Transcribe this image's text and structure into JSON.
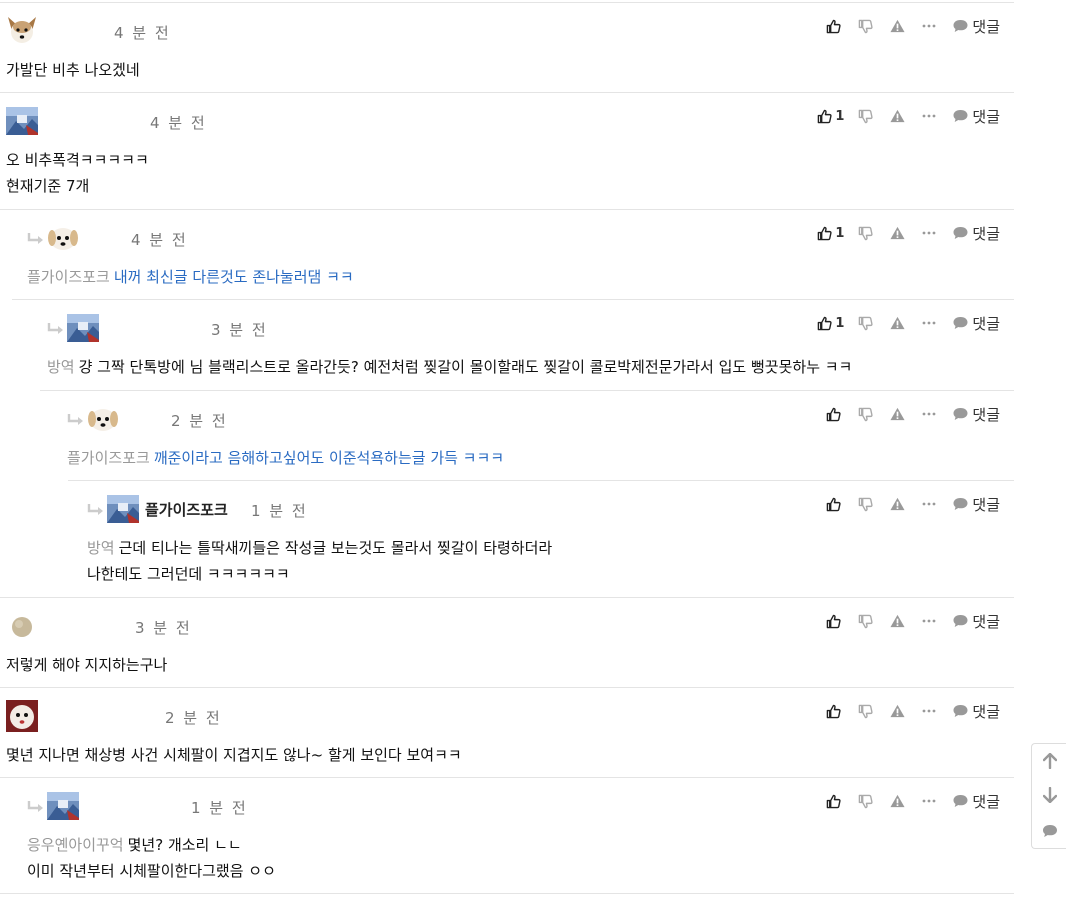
{
  "reply_label": "댓글",
  "comments": [
    {
      "time": "4 분 전",
      "avatar": "dog-tan",
      "nick": "",
      "depth": 0,
      "likes": "",
      "mention": "",
      "lines": [
        "가발단 비추 나오겠네"
      ],
      "link": false
    },
    {
      "time": "4 분 전",
      "avatar": "blue-gradient",
      "nick": "",
      "depth": 0,
      "likes": "1",
      "mention": "",
      "lines": [
        "오 비추폭격ㅋㅋㅋㅋㅋ",
        "현재기준 7개"
      ],
      "link": false
    },
    {
      "time": "4 분 전",
      "avatar": "dog-white",
      "nick": "",
      "depth": 1,
      "likes": "1",
      "mention": "플가이즈포크",
      "lines": [
        "내꺼 최신글 다른것도 존나눌러댐 ㅋㅋ"
      ],
      "link": true
    },
    {
      "time": "3 분 전",
      "avatar": "blue-gradient",
      "nick": "",
      "depth": 2,
      "likes": "1",
      "mention": "방역",
      "lines": [
        "걍 그짝 단톡방에 님 블랙리스트로 올라간듯? 예전처럼 찢갈이 몰이할래도 찢갈이 콜로박제전문가라서 입도 뻥끗못하누 ㅋㅋ"
      ],
      "link": false
    },
    {
      "time": "2 분 전",
      "avatar": "dog-white",
      "nick": "",
      "depth": 3,
      "likes": "",
      "mention": "플가이즈포크",
      "lines": [
        "깨준이라고 음해하고싶어도 이준석욕하는글 가득 ㅋㅋㅋ"
      ],
      "link": true
    },
    {
      "time": "1 분 전",
      "avatar": "blue-gradient",
      "nick": "플가이즈포크",
      "depth": 4,
      "likes": "",
      "mention": "방역",
      "lines": [
        "근데 티나는 틀딱새끼들은 작성글 보는것도 몰라서 찢갈이 타령하더라",
        "나한테도 그러던데 ㅋㅋㅋㅋㅋㅋ"
      ],
      "link": false
    },
    {
      "time": "3 분 전",
      "avatar": "beige-circle",
      "nick": "",
      "depth": 0,
      "likes": "",
      "mention": "",
      "lines": [
        "저렇게 해야 지지하는구나"
      ],
      "link": false
    },
    {
      "time": "2 분 전",
      "avatar": "dog-red",
      "nick": "",
      "depth": 0,
      "likes": "",
      "mention": "",
      "lines": [
        "몇년 지나면 채상병 사건 시체팔이 지겹지도 않나~ 할게 보인다 보여ㅋㅋ"
      ],
      "link": false
    },
    {
      "time": "1 분 전",
      "avatar": "blue-gradient",
      "nick": "",
      "depth": 1,
      "likes": "",
      "mention": "응우옌아이꾸억",
      "lines": [
        "몇년? 개소리 ㄴㄴ",
        "이미 작년부터 시체팔이한다그랬음 ㅇㅇ"
      ],
      "link": false
    }
  ],
  "icons": {
    "like": "thumbs-up-icon",
    "dislike": "thumbs-down-icon",
    "report": "warning-icon",
    "more": "more-dots-icon",
    "reply": "speech-bubble-icon",
    "reply_arrow": "reply-arrow-icon",
    "scroll_up": "arrow-up-icon",
    "scroll_down": "arrow-down-icon",
    "scroll_comment": "comment-icon"
  },
  "colors": {
    "link": "#2a6bc2",
    "mention": "#999999",
    "icon": "#888888",
    "time": "#777777"
  }
}
